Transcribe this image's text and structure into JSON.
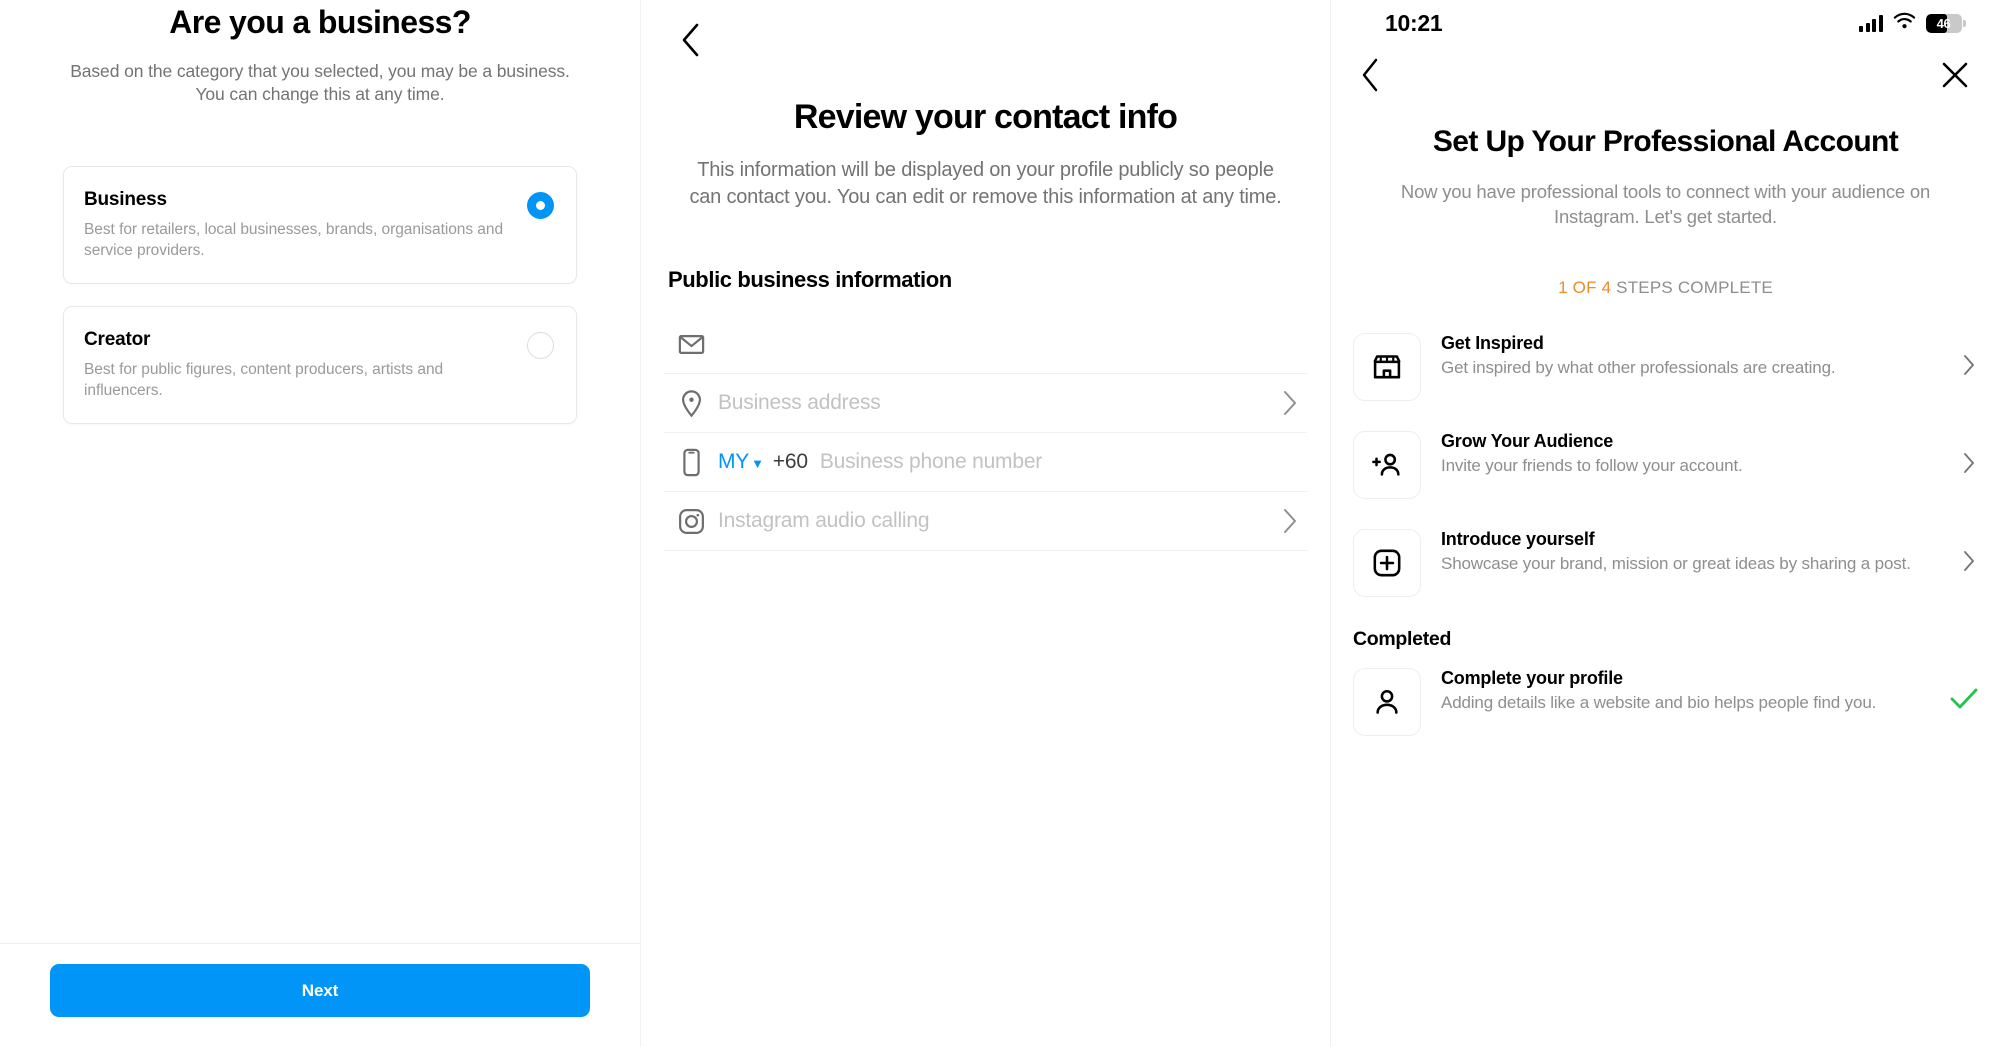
{
  "screen1": {
    "title": "Are you a business?",
    "subtitle": "Based on the category that you selected, you may be a business. You can change this at any time.",
    "options": [
      {
        "name": "Business",
        "description": "Best for retailers, local businesses, brands, organisations and service providers.",
        "selected": true
      },
      {
        "name": "Creator",
        "description": "Best for public figures, content producers, artists and influencers.",
        "selected": false
      }
    ],
    "next_label": "Next",
    "accent_color": "#0095f6"
  },
  "screen2": {
    "back_icon": "chevron-left-icon",
    "title": "Review your contact info",
    "subtitle": "This information will be displayed on your profile publicly so people can contact you. You can edit or remove this information at any time.",
    "section_title": "Public business information",
    "rows": [
      {
        "icon": "envelope-icon",
        "placeholder": "",
        "value": "",
        "chevron": false
      },
      {
        "icon": "location-pin-icon",
        "placeholder": "Business address",
        "value": "",
        "chevron": true
      },
      {
        "icon": "mobile-phone-icon",
        "country_code": "MY",
        "dial_code": "+60",
        "placeholder": "Business phone number",
        "value": "",
        "chevron": false
      },
      {
        "icon": "instagram-icon",
        "placeholder": "Instagram audio calling",
        "value": "",
        "chevron": true
      }
    ],
    "country_code_color": "#0095f6"
  },
  "screen3": {
    "statusbar": {
      "time": "10:21",
      "cellular_icon": "signal-bars-icon",
      "wifi_icon": "wifi-icon",
      "battery_icon": "battery-icon",
      "battery_level": "46"
    },
    "nav": {
      "back_icon": "chevron-left-icon",
      "close_icon": "close-x-icon"
    },
    "title": "Set Up Your Professional Account",
    "subtitle": "Now you have professional tools to connect with your audience on Instagram. Let's get started.",
    "progress": {
      "highlight": "1 OF 4",
      "rest": " STEPS COMPLETE",
      "highlight_color": "#ed8b2b"
    },
    "tasks": [
      {
        "icon": "storefront-icon",
        "title": "Get Inspired",
        "description": "Get inspired by what other professionals are creating.",
        "chevron": true
      },
      {
        "icon": "add-person-icon",
        "title": "Grow Your Audience",
        "description": "Invite your friends to follow your account.",
        "chevron": true
      },
      {
        "icon": "plus-square-icon",
        "title": "Introduce yourself",
        "description": "Showcase your brand, mission or great ideas by sharing a post.",
        "chevron": true
      }
    ],
    "completed_title": "Completed",
    "completed_tasks": [
      {
        "icon": "person-icon",
        "title": "Complete your profile",
        "description": "Adding details like a website and bio helps people find you.",
        "check_color": "#21c44d"
      }
    ]
  }
}
